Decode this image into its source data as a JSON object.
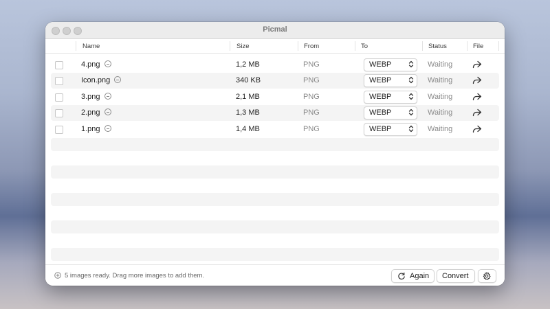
{
  "window": {
    "title": "Picmal"
  },
  "columns": {
    "name": "Name",
    "size": "Size",
    "from": "From",
    "to": "To",
    "status": "Status",
    "file": "File"
  },
  "rows": [
    {
      "name": "4.png",
      "size": "1,2 MB",
      "from": "PNG",
      "to": "WEBP",
      "status": "Waiting"
    },
    {
      "name": "Icon.png",
      "size": "340 KB",
      "from": "PNG",
      "to": "WEBP",
      "status": "Waiting"
    },
    {
      "name": "3.png",
      "size": "2,1 MB",
      "from": "PNG",
      "to": "WEBP",
      "status": "Waiting"
    },
    {
      "name": "2.png",
      "size": "1,3 MB",
      "from": "PNG",
      "to": "WEBP",
      "status": "Waiting"
    },
    {
      "name": "1.png",
      "size": "1,4 MB",
      "from": "PNG",
      "to": "WEBP",
      "status": "Waiting"
    }
  ],
  "footer": {
    "status_text": "5 images ready. Drag more images to add them.",
    "again_label": "Again",
    "convert_label": "Convert"
  },
  "icons": {
    "remove": "minus-circle-icon",
    "share": "share-arrow-icon",
    "select": "chevron-updown-icon",
    "add": "plus-circle-icon",
    "again": "refresh-icon",
    "settings": "gear-icon"
  }
}
